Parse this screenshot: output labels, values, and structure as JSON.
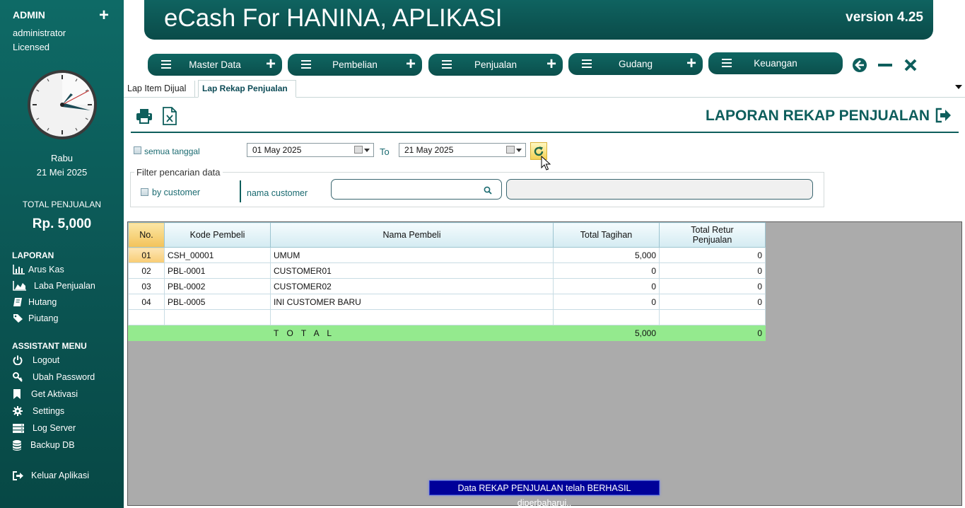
{
  "sidebar": {
    "role": "ADMIN",
    "plus": "+",
    "user": "administrator",
    "license": "Licensed",
    "day": "Rabu",
    "date": "21 Mei 2025",
    "total_label": "TOTAL PENJUALAN",
    "total_value": "Rp. 5,000",
    "laporan_title": "LAPORAN",
    "laporan": [
      {
        "label": "Arus Kas",
        "icon": "bar-chart-icon"
      },
      {
        "label": "Laba Penjualan",
        "icon": "area-chart-icon"
      },
      {
        "label": "Hutang",
        "icon": "book-icon"
      },
      {
        "label": "Piutang",
        "icon": "tags-icon"
      }
    ],
    "assistant_title": "ASSISTANT MENU",
    "assistant": [
      {
        "label": "Logout",
        "icon": "power-icon"
      },
      {
        "label": "Ubah Password",
        "icon": "key-icon"
      },
      {
        "label": "Get Aktivasi",
        "icon": "bookmark-icon"
      },
      {
        "label": "Settings",
        "icon": "gear-icon"
      },
      {
        "label": "Log Server",
        "icon": "server-icon"
      },
      {
        "label": "Backup DB",
        "icon": "database-icon"
      }
    ],
    "exit_label": "Keluar Aplikasi"
  },
  "header": {
    "title": "eCash For HANINA, APLIKASI",
    "version": "version 4.25"
  },
  "menu": [
    {
      "label": "Master Data",
      "plus": "+"
    },
    {
      "label": "Pembelian",
      "plus": "+"
    },
    {
      "label": "Penjualan",
      "plus": "+"
    },
    {
      "label": "Gudang",
      "plus": "+"
    },
    {
      "label": "Keuangan",
      "plus": ""
    }
  ],
  "tabs": [
    {
      "label": "Lap Item Dijual",
      "active": false
    },
    {
      "label": "Lap Rekap Penjualan",
      "active": true
    }
  ],
  "report": {
    "title": "LAPORAN REKAP PENJUALAN",
    "all_dates_label": "semua tanggal",
    "date_from": "01 May 2025",
    "to_label": "To",
    "date_to": "21 May 2025",
    "filter_title": "Filter pencarian data",
    "by_customer_label": "by customer",
    "customer_name_label": "nama customer",
    "search_value": "",
    "customer_name_value": ""
  },
  "table": {
    "columns": [
      "No.",
      "Kode Pembeli",
      "Nama Pembeli",
      "Total Tagihan",
      "Total Retur Penjualan"
    ],
    "rows": [
      {
        "no": "01",
        "kode": "CSH_00001",
        "nama": "UMUM",
        "tagihan": "5,000",
        "retur": "0"
      },
      {
        "no": "02",
        "kode": "PBL-0001",
        "nama": "CUSTOMER01",
        "tagihan": "0",
        "retur": "0"
      },
      {
        "no": "03",
        "kode": "PBL-0002",
        "nama": "CUSTOMER02",
        "tagihan": "0",
        "retur": "0"
      },
      {
        "no": "04",
        "kode": "PBL-0005",
        "nama": "INI CUSTOMER BARU",
        "tagihan": "0",
        "retur": "0"
      }
    ],
    "total": {
      "label": "T O T A L",
      "tagihan": "5,000",
      "retur": "0"
    }
  },
  "status_message": "Data REKAP PENJUALAN telah BERHASIL diperbaharui..",
  "colors": {
    "teal_dark": "#0b5553",
    "teal_title": "#0e5e5c",
    "total_row": "#94ea8e",
    "status_bg": "#000099",
    "grid_bg": "#ababab"
  }
}
